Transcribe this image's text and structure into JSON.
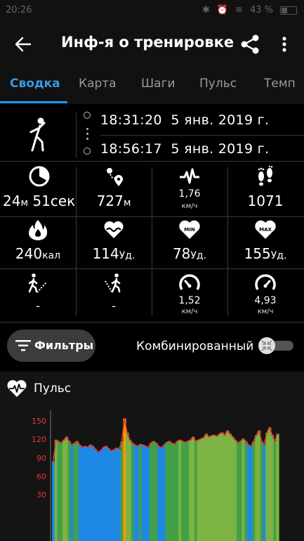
{
  "status_bar": {
    "time": "20:26",
    "battery": "43 %"
  },
  "app_bar": {
    "title": "Инф-я о тренировке"
  },
  "tabs": [
    {
      "label": "Сводка",
      "active": true
    },
    {
      "label": "Карта"
    },
    {
      "label": "Шаги"
    },
    {
      "label": "Пульс"
    },
    {
      "label": "Темп"
    }
  ],
  "workout": {
    "activity_icon": "walking-person-icon",
    "start_time": "18:31:20",
    "start_date": "5 янв. 2019 г.",
    "end_time": "18:56:17",
    "end_date": "5 янв. 2019 г."
  },
  "stats": {
    "duration": {
      "icon": "timer-icon",
      "value1": "24",
      "unit1": "м",
      "value2": "51",
      "unit2": "сек"
    },
    "distance": {
      "icon": "route-icon",
      "value": "727",
      "unit": "м"
    },
    "avg_speed": {
      "icon": "speed-wave-icon",
      "value": "1,76",
      "unit": "км/ч"
    },
    "steps": {
      "icon": "footprints-icon",
      "value": "1071"
    },
    "calories": {
      "icon": "flame-icon",
      "value": "240",
      "unit": "кал"
    },
    "avg_heart_rate": {
      "icon": "heart-wave-icon",
      "value": "114",
      "unit": "Уд."
    },
    "min_heart_rate": {
      "icon": "heart-min-icon",
      "badge": "MIN",
      "value": "78",
      "unit": "Уд."
    },
    "max_heart_rate": {
      "icon": "heart-max-icon",
      "badge": "MAX",
      "value": "155",
      "unit": "Уд."
    },
    "ascent": {
      "icon": "walk-uphill-icon",
      "value": "-"
    },
    "descent": {
      "icon": "walk-downhill-icon",
      "value": "-"
    },
    "min_speed": {
      "icon": "speedometer-low-icon",
      "value": "1,52",
      "unit": "км/ч"
    },
    "max_speed": {
      "icon": "speedometer-high-icon",
      "value": "4,93",
      "unit": "км/ч"
    }
  },
  "controls": {
    "filters_label": "Фильтры",
    "combined_label": "Комбинированный",
    "combined_enabled": false
  },
  "chart_data": {
    "type": "area",
    "title": "Пульс",
    "yticks": [
      150,
      120,
      90,
      60,
      30
    ],
    "ylim": [
      0,
      165
    ],
    "values": [
      85,
      120,
      118,
      115,
      120,
      125,
      118,
      112,
      115,
      118,
      112,
      108,
      110,
      108,
      112,
      110,
      105,
      100,
      103,
      108,
      110,
      106,
      102,
      104,
      107,
      105,
      118,
      155,
      132,
      120,
      115,
      112,
      110,
      113,
      112,
      110,
      108,
      115,
      118,
      115,
      110,
      107,
      112,
      116,
      118,
      115,
      113,
      118,
      120,
      118,
      116,
      118,
      120,
      125,
      118,
      120,
      122,
      124,
      130,
      125,
      127,
      128,
      126,
      130,
      132,
      128,
      135,
      130,
      125,
      120,
      115,
      118,
      122,
      118,
      112,
      110,
      118,
      128,
      135,
      118,
      112,
      132,
      140,
      128,
      118,
      130
    ],
    "zone_colors": {
      "low": "#1e88e5",
      "moderate": "#7cb342",
      "high": "#43a047",
      "peak": "#ff9800"
    }
  }
}
